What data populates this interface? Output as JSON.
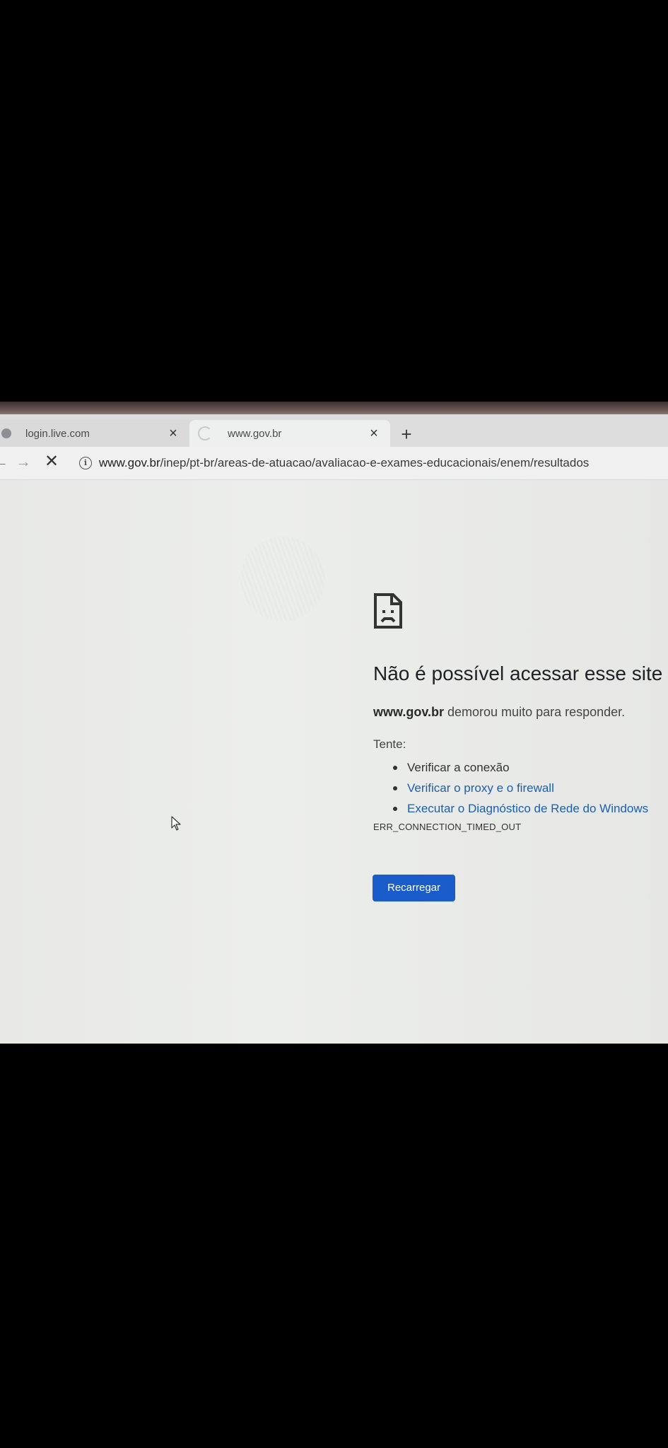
{
  "tabs": [
    {
      "title": "login.live.com",
      "close": "×"
    },
    {
      "title": "www.gov.br",
      "close": "×"
    }
  ],
  "new_tab_symbol": "+",
  "toolbar": {
    "back_symbol": "←",
    "forward_symbol": "→",
    "stop_symbol": "✕",
    "info_symbol": "i",
    "url_host": "www.gov.br",
    "url_path": "/inep/pt-br/areas-de-atuacao/avaliacao-e-exames-educacionais/enem/resultados"
  },
  "error_page": {
    "title": "Não é possível acessar esse site",
    "host": "www.gov.br",
    "description_suffix": " demorou muito para responder.",
    "try_label": "Tente:",
    "suggestions": [
      "Verificar a conexão",
      "Verificar o proxy e o firewall",
      "Executar o Diagnóstico de Rede do Windows"
    ],
    "error_code": "ERR_CONNECTION_TIMED_OUT",
    "reload_label": "Recarregar"
  },
  "icons": {
    "sad_page": "sad-page-icon",
    "cursor": "mouse-cursor-icon",
    "loading": "loading-spinner-icon"
  },
  "colors": {
    "link": "#1a5fb4",
    "button": "#1a5cc9"
  }
}
